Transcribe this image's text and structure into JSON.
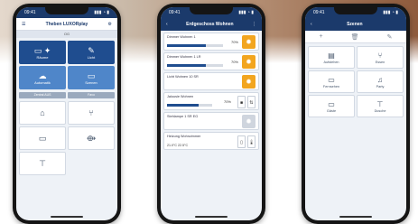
{
  "colors": {
    "header": "#1b3a6b",
    "tile_dark": "#1f4d8f",
    "tile_light": "#4f86c9",
    "lamp_on": "#f2a51f"
  },
  "status": {
    "time": "09:41",
    "signal": "▮▮▮ ◔ ▮"
  },
  "phone1": {
    "logo": "Theben LUXORplay",
    "subheader": "OG",
    "tiles": [
      {
        "icon": "light-bulb-icon",
        "glyph": "▭ ✦",
        "label": "Räume",
        "style": "dark"
      },
      {
        "icon": "edit-icon",
        "glyph": "✎",
        "label": "Licht",
        "style": "dark"
      },
      {
        "icon": "weather-icon",
        "glyph": "☁",
        "label": "Automatik",
        "style": "light"
      },
      {
        "icon": "folder-icon",
        "glyph": "▭",
        "label": "Szenen",
        "style": "light"
      }
    ],
    "pills": [
      "Zentral AUS",
      "Favo"
    ],
    "more_tiles": [
      {
        "icon": "camera-icon",
        "glyph": "⌂"
      },
      {
        "icon": "fork-icon",
        "glyph": "⑂"
      },
      {
        "icon": "monitor-icon",
        "glyph": "▭"
      },
      {
        "icon": "route-icon",
        "glyph": "⟴"
      },
      {
        "icon": "tool-icon",
        "glyph": "⊤"
      }
    ]
  },
  "phone2": {
    "title": "Erdgeschoss Wohnen",
    "rows": [
      {
        "label": "Dimmer Wohnen 1",
        "percent": "70%",
        "level": 0.7,
        "lamp": "on"
      },
      {
        "label": "Dimmer Wohnen 1 LR",
        "percent": "70%",
        "level": 0.7,
        "lamp": "on"
      },
      {
        "label": "Licht Wohnen 10 SR",
        "percent": "",
        "level": 0,
        "lamp": "on"
      },
      {
        "label": "Jalousie Wohnen",
        "percent": "70%",
        "level": 0.7,
        "lamp": "ctrl"
      },
      {
        "label": "Stehlampe 1 SR EG",
        "percent": "",
        "level": 0,
        "lamp": "off"
      },
      {
        "label": "Heizung Wohnzimmer",
        "percent": "",
        "level": 0,
        "lamp": "temp",
        "temp": "21.0°C    22.5°C"
      }
    ]
  },
  "phone3": {
    "title": "Szenen",
    "toolbar": [
      "+",
      "🗑",
      "✎"
    ],
    "tiles": [
      {
        "icon": "clipboard-icon",
        "glyph": "▤",
        "label": "Aufstehen"
      },
      {
        "icon": "cutlery-icon",
        "glyph": "⑂",
        "label": "Essen"
      },
      {
        "icon": "tv-icon",
        "glyph": "▭",
        "label": "Fernsehen"
      },
      {
        "icon": "party-icon",
        "glyph": "♫",
        "label": "Party"
      },
      {
        "icon": "folder-icon",
        "glyph": "▭",
        "label": "Gäste"
      },
      {
        "icon": "shower-icon",
        "glyph": "⊤",
        "label": "Dusche"
      }
    ]
  }
}
